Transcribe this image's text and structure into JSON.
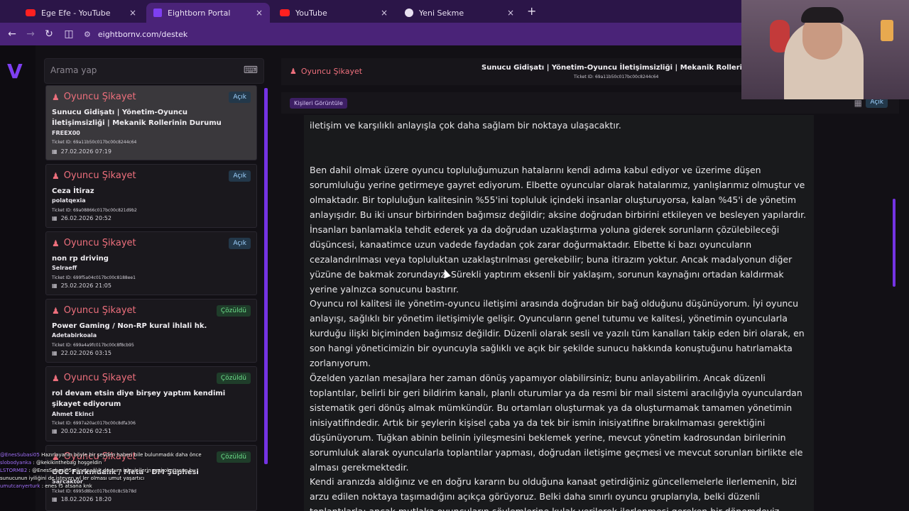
{
  "browser": {
    "tabs": [
      {
        "label": "Ege Efe - YouTube",
        "icon": "youtube-icon"
      },
      {
        "label": "Eightborn Portal",
        "icon": "eightborn-icon",
        "active": true
      },
      {
        "label": "YouTube",
        "icon": "youtube-icon"
      },
      {
        "label": "Yeni Sekme",
        "icon": "chrome-icon"
      }
    ],
    "close_glyph": "×",
    "newtab_glyph": "+",
    "url": "eightbornv.com/destek"
  },
  "app": {
    "logo": "V",
    "search_placeholder": "Arama yap",
    "tickets": [
      {
        "type": "Oyuncu Şikayet",
        "status": "Açık",
        "status_kind": "open",
        "title": "Sunucu Gidişatı | Yönetim-Oyuncu İletişimsizliği | Mekanik Rollerinin Durumu",
        "user": "FREEX00",
        "ticket_id": "Ticket ID: 69a11b50c017bc00c8244c64",
        "date": "27.02.2026 07:19"
      },
      {
        "type": "Oyuncu Şikayet",
        "status": "Açık",
        "status_kind": "open",
        "title": "Ceza İtiraz",
        "user": "polatqexia",
        "ticket_id": "Ticket ID: 69a08866c017bc00c821d9b2",
        "date": "26.02.2026 20:52"
      },
      {
        "type": "Oyuncu Şikayet",
        "status": "Açık",
        "status_kind": "open",
        "title": "non rp driving",
        "user": "Selraeff",
        "ticket_id": "Ticket ID: 699f5a04c017bc00c8188ee1",
        "date": "25.02.2026 21:05"
      },
      {
        "type": "Oyuncu Şikayet",
        "status": "Çözüldü",
        "status_kind": "resolved",
        "title": "Power Gaming / Non-RP kural ihlali hk.",
        "user": "Adetabirkoala",
        "ticket_id": "Ticket ID: 699a4a9fc017bc00c8f8cb95",
        "date": "22.02.2026 03:15"
      },
      {
        "type": "Oyuncu Şikayet",
        "status": "Çözüldü",
        "status_kind": "resolved",
        "title": "rol devam etsin diye birşey yaptım kendimi şikayet ediyorum",
        "user": "Ahmet Ekinci",
        "ticket_id": "Ticket ID: 6997a20ac017bc00c8dfa306",
        "date": "20.02.2026 02:51"
      },
      {
        "type": "Oyuncu Şikayet",
        "status": "Çözüldü",
        "status_kind": "resolved",
        "title": "OOC Farkındalık / Meta - DM Şüphesi",
        "user": "Sarcaktor",
        "ticket_id": "Ticket ID: 6995d8bcc017bc00c8c5b78d",
        "date": "18.02.2026 18:20"
      }
    ],
    "detail": {
      "type": "Oyuncu Şikayet",
      "title": "Sunucu Gidişatı | Yönetim-Oyuncu İletişimsizliği | Mekanik Rollerinin Durumu",
      "ticket_id": "Ticket ID: 69a11b50c017bc00c8244c64",
      "view_people": "Kişileri Görüntüle",
      "status": "Açık",
      "paragraphs": [
        "iletişim ve karşılıklı anlayışla çok daha sağlam bir noktaya ulaşacaktır.",
        "Ben dahil olmak üzere oyuncu topluluğumuzun hatalarını kendi adıma kabul ediyor ve üzerime düşen sorumluluğu yerine getirmeye gayret ediyorum. Elbette oyuncular olarak hatalarımız, yanlışlarımız olmuştur ve olmaktadır. Bir topluluğun kalitesinin %55'ini topluluk içindeki insanlar oluşturuyorsa, kalan %45'i de yönetim anlayışıdır. Bu iki unsur birbirinden bağımsız değildir; aksine doğrudan birbirini etkileyen ve besleyen yapılardır. İnsanları banlamakla tehdit ederek ya da doğrudan uzaklaştırma yoluna giderek sorunların çözülebileceği düşüncesi, kanaatimce uzun vadede faydadan çok zarar doğurmaktadır. Elbette ki bazı oyuncuların cezalandırılması veya topluluktan uzaklaştırılması gerekebilir; buna itirazım yoktur. Ancak madalyonun diğer yüzüne de bakmak zorundayız. Sürekli yaptırım eksenli bir yaklaşım, sorunun kaynağını ortadan kaldırmak yerine yalnızca sonucunu bastırır.",
        "Oyuncu rol kalitesi ile yönetim-oyuncu iletişimi arasında doğrudan bir bağ olduğunu düşünüyorum. İyi oyuncu anlayışı, sağlıklı bir yönetim iletişimiyle gelişir. Oyuncuların genel tutumu ve kalitesi, yönetimin oyuncularla kurduğu ilişki biçiminden bağımsız değildir. Düzenli olarak sesli ve yazılı tüm kanalları takip eden biri olarak, en son hangi yöneticimizin bir oyuncuyla sağlıklı ve açık bir şekilde sunucu hakkında konuştuğunu hatırlamakta zorlanıyorum.",
        "Özelden yazılan mesajlara her zaman dönüş yapamıyor olabilirsiniz; bunu anlayabilirim. Ancak düzenli toplantılar, belirli bir geri bildirim kanalı, planlı oturumlar ya da resmi bir mail sistemi aracılığıyla oyunculardan sistematik geri dönüş almak mümkündür. Bu ortamları oluşturmak ya da oluşturmamak tamamen yönetimin inisiyatifindedir. Artık bir şeylerin kişisel çaba ya da tek bir ismin inisiyatifine bırakılmaması gerektiğini düşünüyorum. Tuğkan abinin belinin iyileşmesini beklemek yerine, mevcut yönetim kadrosundan birilerinin sorumluluk alarak oyuncularla toplantılar yapması, doğrudan iletişime geçmesi ve mevcut sorunları birlikte ele alması gerekmektedir.",
        "Kendi aranızda aldığınız ve en doğru kararın bu olduğuna kanaat getirdiğiniz güncellemelerle ilerlemenin, bizi arzu edilen noktaya taşımadığını açıkça görüyoruz. Belki daha sınırlı oyuncu gruplarıyla, belki düzenli toplantılarla; ancak mutlaka oyuncuların söylemlerine kulak verilerek ilerlenmesi gereken bir dönemdeyiz."
      ]
    }
  },
  "chat": [
    {
      "name": "@EnesSubasi05",
      "text": "Hazırlayanın böyle bir şeyden haberi bile bulunmadık daha önce"
    },
    {
      "name": "slobodyanka",
      "text": ": @kekikinthebag hoşgeldin"
    },
    {
      "name": "LSTORMB2",
      "text": ": @EnesSubasi05 eline sağlık dostum izleyicilerin sesi olmuşsun bu sunucunun iyiliğini de isteyen wl ler olması umut yaşartıcı"
    },
    {
      "name": "umutcanyerturk",
      "text": ": enes f5 atsana knk"
    }
  ]
}
